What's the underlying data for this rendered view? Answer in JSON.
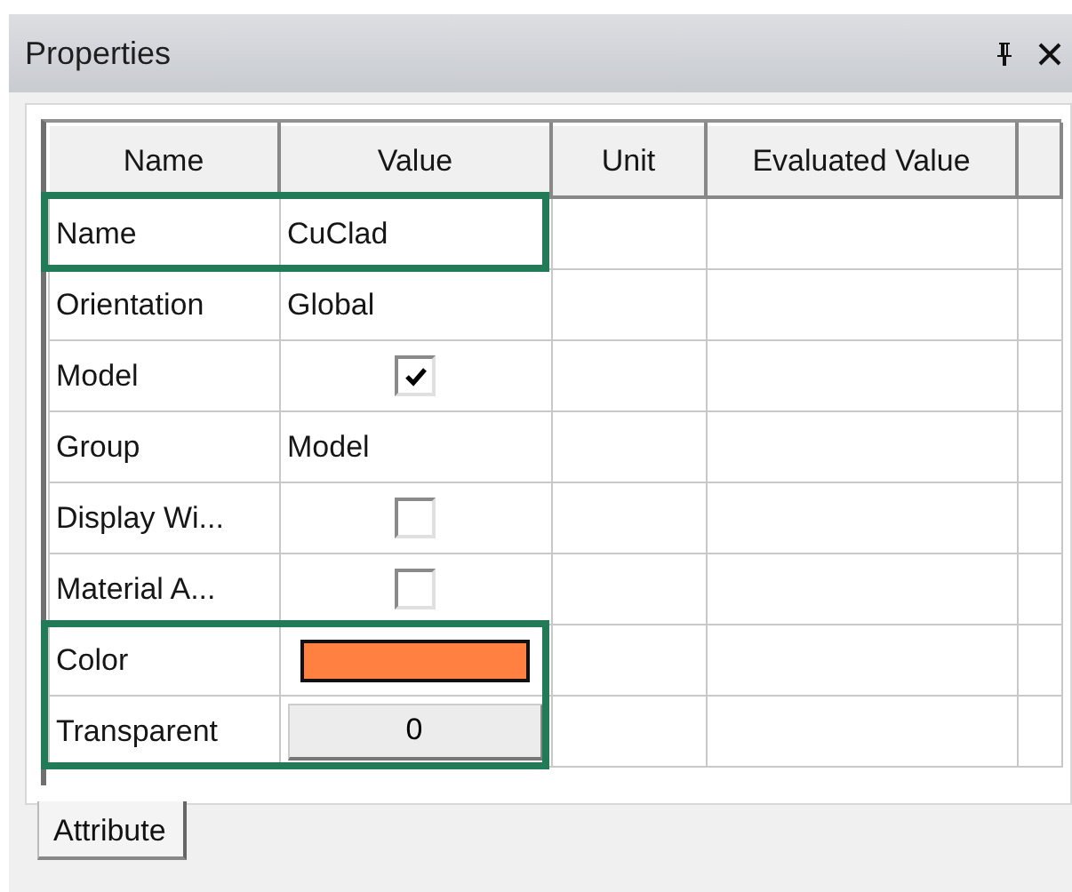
{
  "panel": {
    "title": "Properties"
  },
  "table": {
    "columns": [
      "Name",
      "Value",
      "Unit",
      "Evaluated Value"
    ],
    "rows": [
      {
        "name": "Name",
        "kind": "text",
        "value": "CuClad",
        "highlighted": true
      },
      {
        "name": "Orientation",
        "kind": "text",
        "value": "Global",
        "highlighted": false
      },
      {
        "name": "Model",
        "kind": "checkbox",
        "checked": true,
        "highlighted": false
      },
      {
        "name": "Group",
        "kind": "text",
        "value": "Model",
        "highlighted": false
      },
      {
        "name": "Display Wi...",
        "kind": "checkbox",
        "checked": false,
        "highlighted": false
      },
      {
        "name": "Material A...",
        "kind": "checkbox",
        "checked": false,
        "highlighted": false
      },
      {
        "name": "Color",
        "kind": "color",
        "color": "#ff8040",
        "highlighted": true
      },
      {
        "name": "Transparent",
        "kind": "button",
        "value": "0",
        "highlighted": true
      }
    ]
  },
  "tabs": [
    {
      "label": "Attribute",
      "selected": true
    }
  ]
}
